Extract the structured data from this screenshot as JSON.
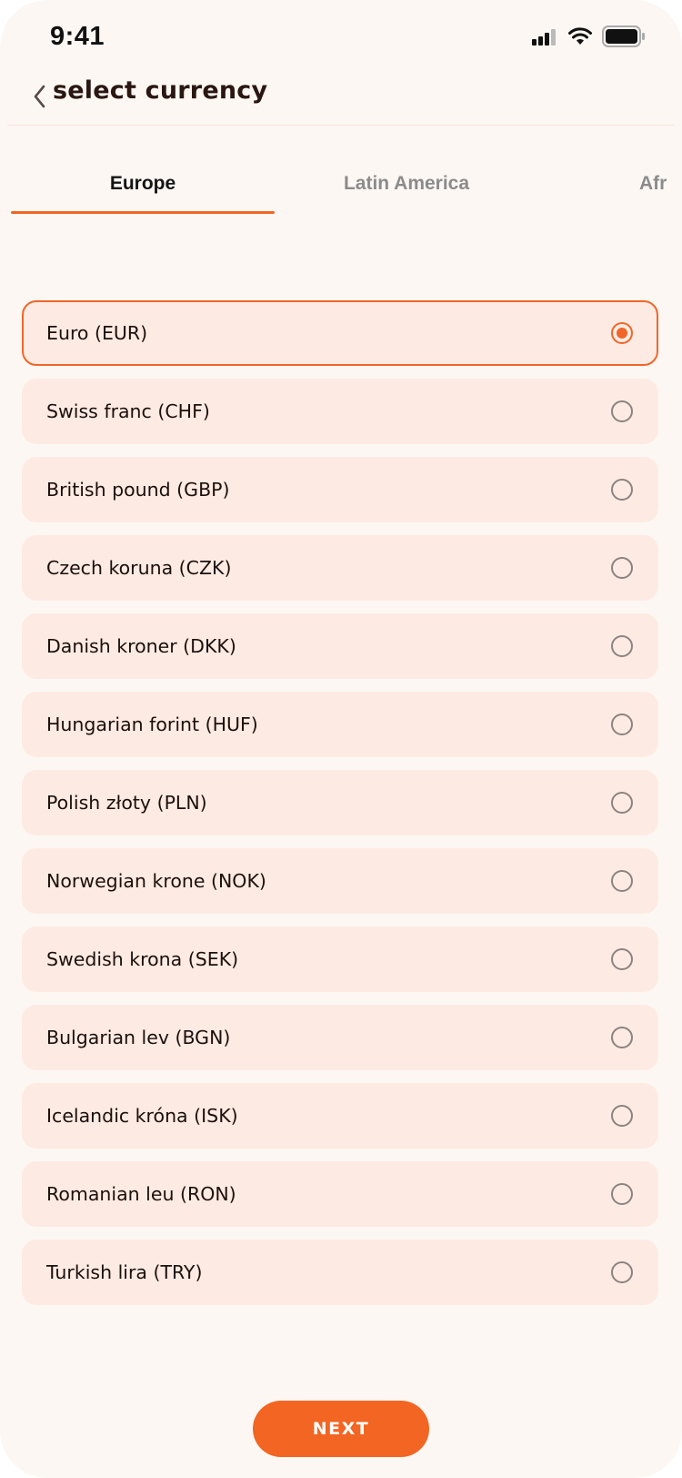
{
  "status_bar": {
    "time": "9:41",
    "icons": [
      "cellular-signal-icon",
      "wifi-icon",
      "battery-icon"
    ]
  },
  "header": {
    "back_icon": "chevron-left-icon",
    "title": "select currency"
  },
  "tabs": [
    {
      "label": "Europe",
      "active": true
    },
    {
      "label": "Latin America",
      "active": false
    },
    {
      "label": "Afr",
      "active": false
    }
  ],
  "currencies": [
    {
      "label": "Euro (EUR)",
      "selected": true
    },
    {
      "label": "Swiss franc (CHF)",
      "selected": false
    },
    {
      "label": "British pound (GBP)",
      "selected": false
    },
    {
      "label": "Czech koruna (CZK)",
      "selected": false
    },
    {
      "label": "Danish kroner (DKK)",
      "selected": false
    },
    {
      "label": "Hungarian forint (HUF)",
      "selected": false
    },
    {
      "label": "Polish złoty (PLN)",
      "selected": false
    },
    {
      "label": "Norwegian krone (NOK)",
      "selected": false
    },
    {
      "label": "Swedish krona (SEK)",
      "selected": false
    },
    {
      "label": "Bulgarian lev (BGN)",
      "selected": false
    },
    {
      "label": "Icelandic króna (ISK)",
      "selected": false
    },
    {
      "label": "Romanian leu (RON)",
      "selected": false
    },
    {
      "label": "Turkish lira (TRY)",
      "selected": false
    }
  ],
  "footer": {
    "next_label": "NEXT"
  },
  "colors": {
    "accent": "#f26522",
    "background": "#fdf7f3",
    "item_background": "#fdebe3",
    "text_primary": "#1c0f0c",
    "tab_inactive": "#8b8b8b"
  }
}
